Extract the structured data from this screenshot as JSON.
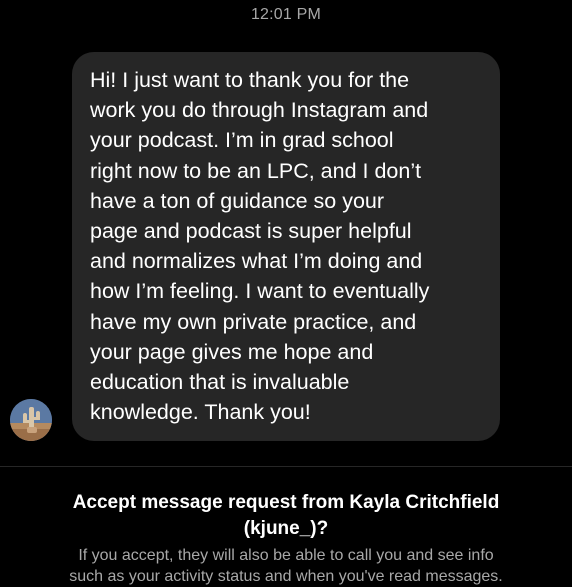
{
  "status": {
    "timestamp": "12:01 PM"
  },
  "message": {
    "lines": [
      "Hi! I just want to thank you for the",
      "work you do through Instagram and",
      "your podcast. I’m in grad school",
      "right now to be an LPC, and I don’t",
      "have a ton of guidance so your",
      "page and podcast is super helpful",
      "and normalizes what I’m doing and",
      "how I’m feeling. I want to eventually",
      "have my own private practice, and",
      "your page gives me hope and",
      "education that is invaluable",
      "knowledge. Thank you!"
    ]
  },
  "request": {
    "title_line1": "Accept message request from Kayla Critchfield",
    "title_line2": "(kjune_)?",
    "info_line1": "If you accept, they will also be able to call you and see info",
    "info_line2": "such as your activity status and when you've read messages."
  },
  "colors": {
    "background": "#000000",
    "bubble": "#262626",
    "secondary_text": "#a8a8a8"
  }
}
